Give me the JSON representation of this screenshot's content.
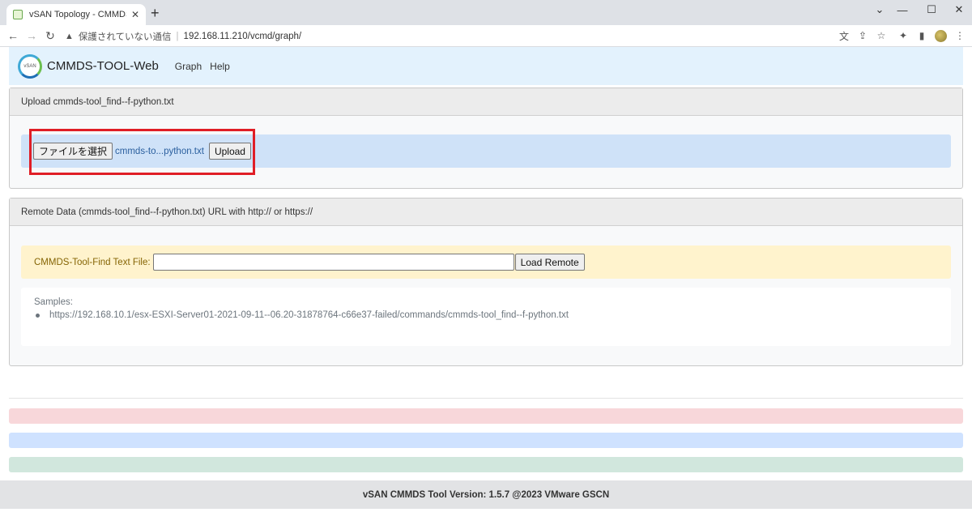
{
  "browser": {
    "tab_title": "vSAN Topology - CMMDS-TOOL",
    "tab_close": "✕",
    "new_tab": "+",
    "security_text": "保護されていない通信",
    "url": "192.168.11.210/vcmd/graph/"
  },
  "app": {
    "brand": "CMMDS-TOOL-Web",
    "logo_text": "vSAN",
    "nav": [
      "Graph",
      "Help"
    ]
  },
  "upload_card": {
    "header": "Upload cmmds-tool_find--f-python.txt",
    "choose_file_label": "ファイルを選択",
    "selected_file": "cmmds-to...python.txt",
    "upload_button": "Upload"
  },
  "remote_card": {
    "header": "Remote Data (cmmds-tool_find--f-python.txt) URL with http:// or https://",
    "input_label": "CMMDS-Tool-Find Text File:",
    "input_value": "",
    "load_button": "Load Remote",
    "samples_label": "Samples:",
    "samples": [
      "https://192.168.10.1/esx-ESXI-Server01-2021-09-11--06.20-31878764-c66e37-failed/commands/cmmds-tool_find--f-python.txt"
    ]
  },
  "alerts": [
    {
      "color": "#f8d7da"
    },
    {
      "color": "#cfe2ff"
    },
    {
      "color": "#d1e7dd"
    }
  ],
  "footer": {
    "text": "vSAN CMMDS Tool Version: 1.5.7 @2023 VMware GSCN"
  },
  "icons": {
    "back": "back-arrow-icon",
    "forward": "forward-arrow-icon",
    "reload": "reload-icon",
    "warning": "warning-icon",
    "translate": "translate-icon",
    "share": "share-icon",
    "bookmark": "star-icon",
    "extensions": "puzzle-icon",
    "sidebar": "sidebar-icon",
    "menu": "kebab-menu-icon"
  }
}
